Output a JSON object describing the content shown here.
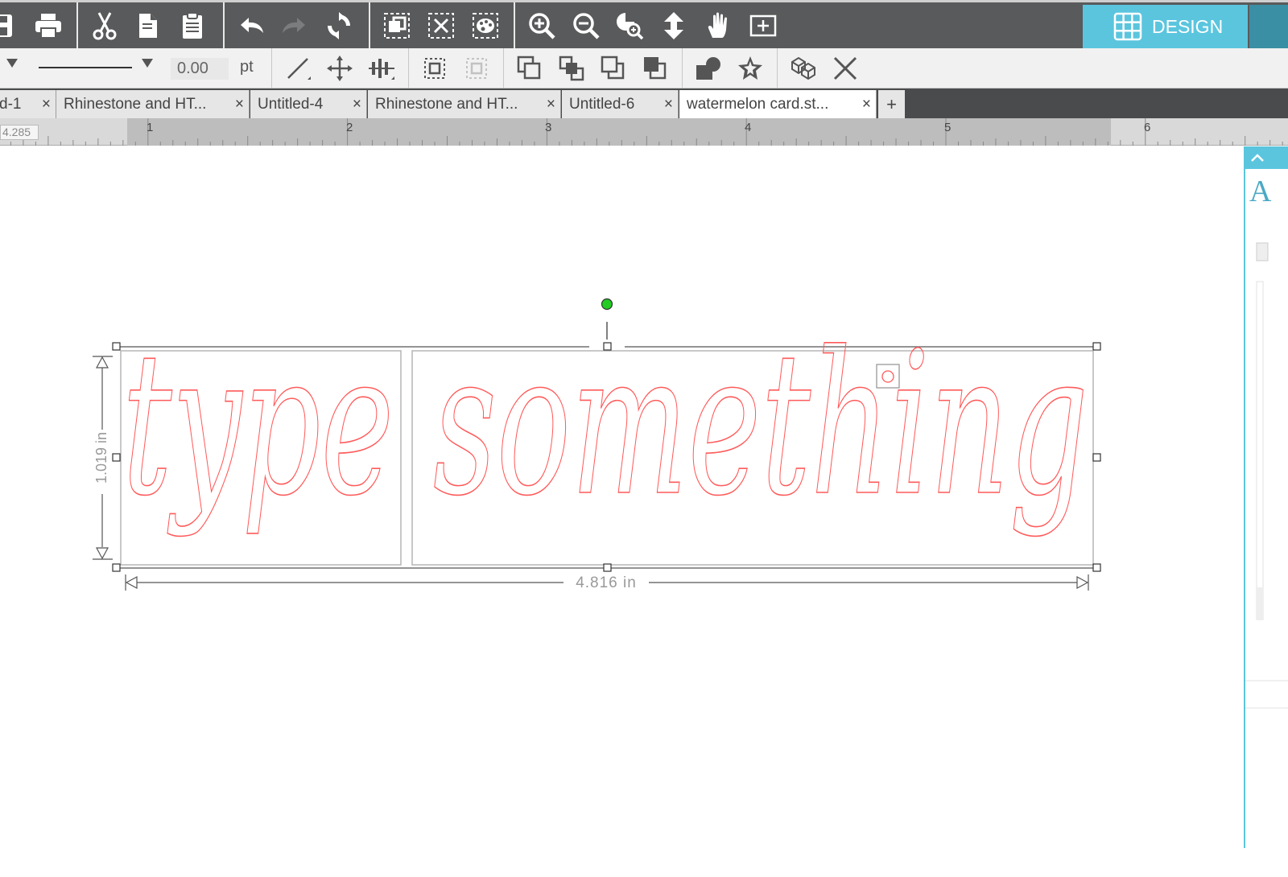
{
  "toolbar": {
    "design_label": "DESIGN",
    "colors": {
      "bar": "#595a5b",
      "design_accent": "#5bc5de",
      "icon": "#ffffff"
    },
    "icons": [
      "save-icon",
      "print-icon",
      "cut-icon",
      "copy-icon",
      "paste-icon",
      "undo-icon",
      "redo-icon",
      "redraw-icon",
      "group-icon",
      "ungroup-icon",
      "fill-icon",
      "zoom-in-icon",
      "zoom-out-icon",
      "zoom-select-icon",
      "drag-zoom-icon",
      "pan-hand-icon",
      "fit-page-icon"
    ]
  },
  "line_settings": {
    "width_value": "0.00",
    "unit": "pt"
  },
  "tabs": [
    {
      "label": "d-1",
      "active": false
    },
    {
      "label": "Rhinestone and HT...",
      "active": false
    },
    {
      "label": "Untitled-4",
      "active": false
    },
    {
      "label": "Rhinestone and HT...",
      "active": false
    },
    {
      "label": "Untitled-6",
      "active": false
    },
    {
      "label": "watermelon card.st...",
      "active": true
    }
  ],
  "tab_close": "×",
  "tab_add": "+",
  "ruler": {
    "readout": "4.285",
    "numbers": [
      "1",
      "2",
      "3",
      "4",
      "5",
      "6"
    ]
  },
  "canvas": {
    "text": "type something",
    "stroke_color": "#ff5a5a",
    "height_label": "1.019 in",
    "width_label": "4.816 in"
  }
}
